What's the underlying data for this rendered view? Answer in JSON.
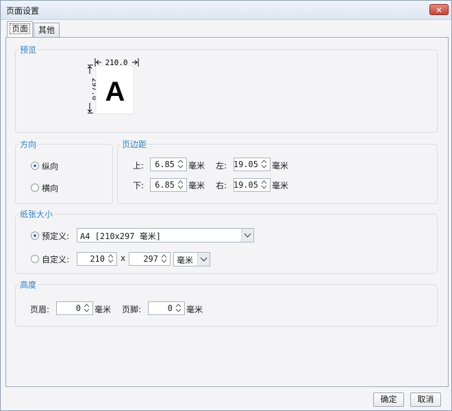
{
  "window": {
    "title": "页面设置",
    "close_glyph": "✕"
  },
  "tabs": [
    {
      "label": "页面"
    },
    {
      "label": "其他"
    }
  ],
  "preview": {
    "title": "预览",
    "width_value": "210.0",
    "height_value": "297.0",
    "sample_letter": "A"
  },
  "orientation": {
    "title": "方向",
    "portrait_label": "纵向",
    "landscape_label": "横向",
    "selected": "portrait"
  },
  "margins": {
    "title": "页边距",
    "top_label": "上:",
    "top_value": "6.85",
    "bottom_label": "下:",
    "bottom_value": "6.85",
    "left_label": "左:",
    "left_value": "19.05",
    "right_label": "右:",
    "right_value": "19.05",
    "unit": "毫米"
  },
  "paper_size": {
    "title": "纸张大小",
    "predefined_label": "预定义:",
    "predefined_value": "A4 [210x297 毫米]",
    "custom_label": "自定义:",
    "custom_width": "210",
    "custom_height": "297",
    "times": "x",
    "custom_unit": "毫米",
    "selected": "predefined"
  },
  "height": {
    "title": "高度",
    "header_label": "页眉:",
    "header_value": "0",
    "footer_label": "页脚:",
    "footer_value": "0",
    "unit": "毫米"
  },
  "buttons": {
    "ok_label": "确定",
    "cancel_label": "取消"
  },
  "colors": {
    "accent": "#2a82c8",
    "radio_dot": "#2e6dc2",
    "close": "#c74536"
  }
}
